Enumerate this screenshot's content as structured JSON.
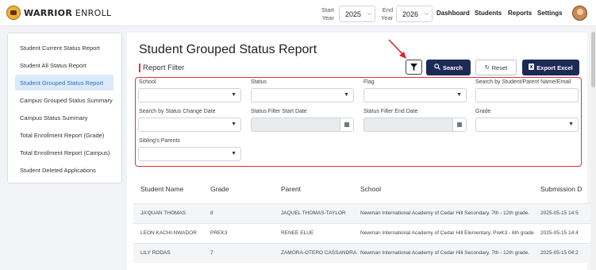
{
  "header": {
    "brand_bold": "WARRIOR",
    "brand_rest": " ENROLL",
    "start_year_label1": "Start",
    "start_year_label2": "Year",
    "start_year_value": "2025",
    "end_year_label1": "End",
    "end_year_label2": "Year",
    "end_year_value": "2026",
    "nav": [
      "Dashboard",
      "Students",
      "Reports",
      "Settings"
    ]
  },
  "sidebar": {
    "items": [
      {
        "label": "Student Current Status Report",
        "active": false
      },
      {
        "label": "Student All Status Report",
        "active": false
      },
      {
        "label": "Student Grouped Status Report",
        "active": true
      },
      {
        "label": "Campus Grouped Status Summary",
        "active": false
      },
      {
        "label": "Campus Status Summary",
        "active": false
      },
      {
        "label": "Total Enrollment Report (Grade)",
        "active": false
      },
      {
        "label": "Total Enrollment Report (Campus)",
        "active": false
      },
      {
        "label": "Student Deleted Applications",
        "active": false
      }
    ]
  },
  "main": {
    "title": "Student Grouped Status Report",
    "subtitle": "Report Filter",
    "buttons": {
      "search": "Search",
      "reset": "Reset",
      "export": "Export Excel"
    },
    "filters": {
      "school": "School",
      "status": "Status",
      "flag": "Flag",
      "search_name": "Search by Student/Parent Name/Email",
      "status_change_date": "Search by Status Change Date",
      "start_date": "Status Filter Start Date",
      "end_date": "Status Filter End Date",
      "grade": "Grade",
      "siblings": "Sibling's Parents"
    },
    "table": {
      "headers": [
        "Student Name",
        "Grade",
        "Parent",
        "School",
        "Submission D"
      ],
      "rows": [
        [
          "JA'QUAN THOMAS",
          "8",
          "JAQUEL THOMAS-TAYLOR",
          "Newman International Academy of Cedar Hill Secondary. 7th - 12th grade.",
          "2025-05-15 14:5"
        ],
        [
          "LEON KACHI-NWADOR",
          "PREK3",
          "RENEE ELUE",
          "Newman International Academy of Cedar Hill Elementary. PreK3 - 6th grade.",
          "2025-05-15 14:4"
        ],
        [
          "LILY RODAS",
          "7",
          "ZAMORA-OTERO CASSANDRA",
          "Newman International Academy of Cedar Hill Secondary. 7th - 12th grade.",
          "2025-05-15 04:2"
        ]
      ]
    }
  },
  "colors": {
    "primary": "#1c2a55",
    "accent_red": "#d9333d",
    "active_bg": "#dbe9f9",
    "active_text": "#2c6fc2"
  },
  "icons": [
    "filter-icon",
    "search-icon",
    "refresh-icon",
    "excel-icon",
    "calendar-icon",
    "chevron-down-icon"
  ]
}
